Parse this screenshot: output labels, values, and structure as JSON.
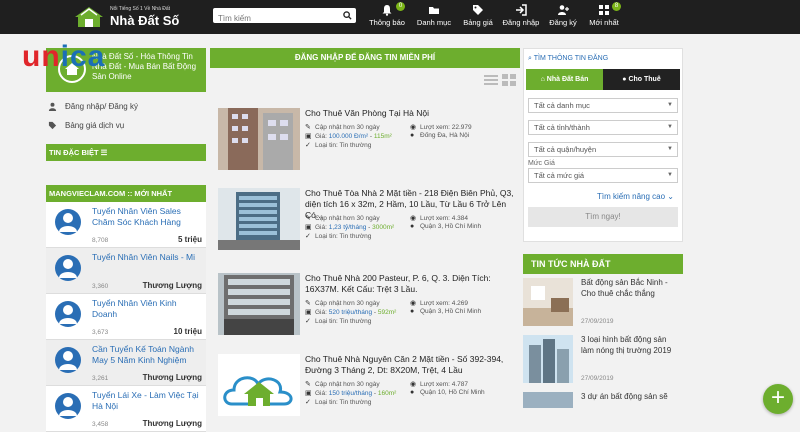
{
  "header": {
    "slogan": "Nổi Tiếng Số 1 Về Nhà Đất",
    "brand": "Nhà Đất Số",
    "search_placeholder": "Tìm kiếm",
    "nav": [
      {
        "label": "Thông báo",
        "icon": "bell-icon",
        "badge": "0"
      },
      {
        "label": "Danh mục",
        "icon": "folder-icon"
      },
      {
        "label": "Bảng giá",
        "icon": "tags-icon"
      },
      {
        "label": "Đăng nhập",
        "icon": "signin-icon"
      },
      {
        "label": "Đăng ký",
        "icon": "user-plus-icon"
      },
      {
        "label": "Mới nhất",
        "icon": "grid-icon",
        "badge": "8"
      }
    ]
  },
  "watermark": {
    "part1": "un",
    "part2": "ica"
  },
  "left": {
    "promo_text": "Nhà Đất Số - Hóa Thông Tin Nhà Đất - Mua Bán Bất Động Sản Online",
    "links": [
      {
        "label": "Đăng nhập/ Đăng ký",
        "icon": "user-icon"
      },
      {
        "label": "Bảng giá dịch vụ",
        "icon": "tag-icon"
      }
    ],
    "section1": "TIN ĐẶC BIỆT ☰",
    "section2": "MANGVIECLAM.COM :: MỚI NHẤT",
    "jobs": [
      {
        "title": "Tuyển Nhân Viên Sales Chăm Sóc Khách Hàng",
        "views": "8,708",
        "salary": "5 triệu"
      },
      {
        "title": "Tuyển Nhân Viên Nails - Mi",
        "views": "3,360",
        "salary": "Thương Lượng"
      },
      {
        "title": "Tuyển Nhân Viên Kinh Doanh",
        "views": "3,673",
        "salary": "10 triệu"
      },
      {
        "title": "Cần Tuyển Kế Toán Ngành May 5 Năm Kinh Nghiệm",
        "views": "3,261",
        "salary": "Thương Lượng"
      },
      {
        "title": "Tuyển Lái Xe - Làm Việc Tại Hà Nội",
        "views": "3,458",
        "salary": "Thương Lượng"
      }
    ]
  },
  "main": {
    "heading": "ĐĂNG NHẬP ĐỂ ĐĂNG TIN MIỄN PHÍ",
    "listings": [
      {
        "title": "Cho Thuê Văn Phòng Tại Hà Nội",
        "updated": "Cập nhật hơn 30 ngày",
        "views": "Lượt xem: 22.979",
        "price_label": "Giá:",
        "price": "100.000 Đ/m²",
        "area": "115m²",
        "location": "Đống Đa, Hà Nội",
        "type": "Loại tin: Tin thường"
      },
      {
        "title": "Cho Thuê Tòa Nhà 2 Mặt tiền - 218 Điện Biên Phủ, Q3, diện tích 16 x 32m, 2 Hầm, 10 Lầu, Từ Lầu 6 Trở Lên Có...",
        "updated": "Cập nhật hơn 30 ngày",
        "views": "Lượt xem: 4.384",
        "price_label": "Giá:",
        "price": "1,23 tỷ/tháng",
        "area": "3000m²",
        "location": "Quận 3, Hồ Chí Minh",
        "type": "Loại tin: Tin thường"
      },
      {
        "title": "Cho Thuê Nhà 200 Pasteur, P. 6, Q. 3. Diện Tích: 16X37M. Kết Cấu: Trệt 3 Lầu.",
        "updated": "Cập nhật hơn 30 ngày",
        "views": "Lượt xem: 4.269",
        "price_label": "Giá:",
        "price": "520 triệu/tháng",
        "area": "592m²",
        "location": "Quận 3, Hồ Chí Minh",
        "type": "Loại tin: Tin thường"
      },
      {
        "title": "Cho Thuê Nhà Nguyên Căn 2 Mặt tiền - Số 392-394, Đường 3 Tháng 2, Dt: 8X20M, Trệt, 4 Lầu",
        "updated": "Cập nhật hơn 30 ngày",
        "views": "Lượt xem: 4.787",
        "price_label": "Giá:",
        "price": "150 triệu/tháng",
        "area": "160m²",
        "location": "Quận 10, Hồ Chí Minh",
        "type": "Loại tin: Tin thường"
      }
    ]
  },
  "right": {
    "search_title": "TÌM THÔNG TIN ĐĂNG",
    "tab_sale": "Nhà Đất Bán",
    "tab_rent": "Cho Thuê",
    "selects": [
      "Tất cả danh mục",
      "Tất cả tỉnh/thành",
      "Tất cả quận/huyện"
    ],
    "price_label": "Mức Giá",
    "price_select": "Tất cả mức giá",
    "advanced": "Tìm kiếm nâng cao",
    "submit": "Tìm ngay!",
    "news_heading": "TIN TỨC NHÀ ĐẤT",
    "news": [
      {
        "title": "Bất động sản Bắc Ninh - Cho thuê chắc thắng",
        "date": "27/09/2019"
      },
      {
        "title": "3 loại hình bất động sản làm nóng thị trường 2019",
        "date": "27/09/2019"
      },
      {
        "title": "3 dự án bất động sản sẽ",
        "date": ""
      }
    ]
  },
  "fab": "+"
}
